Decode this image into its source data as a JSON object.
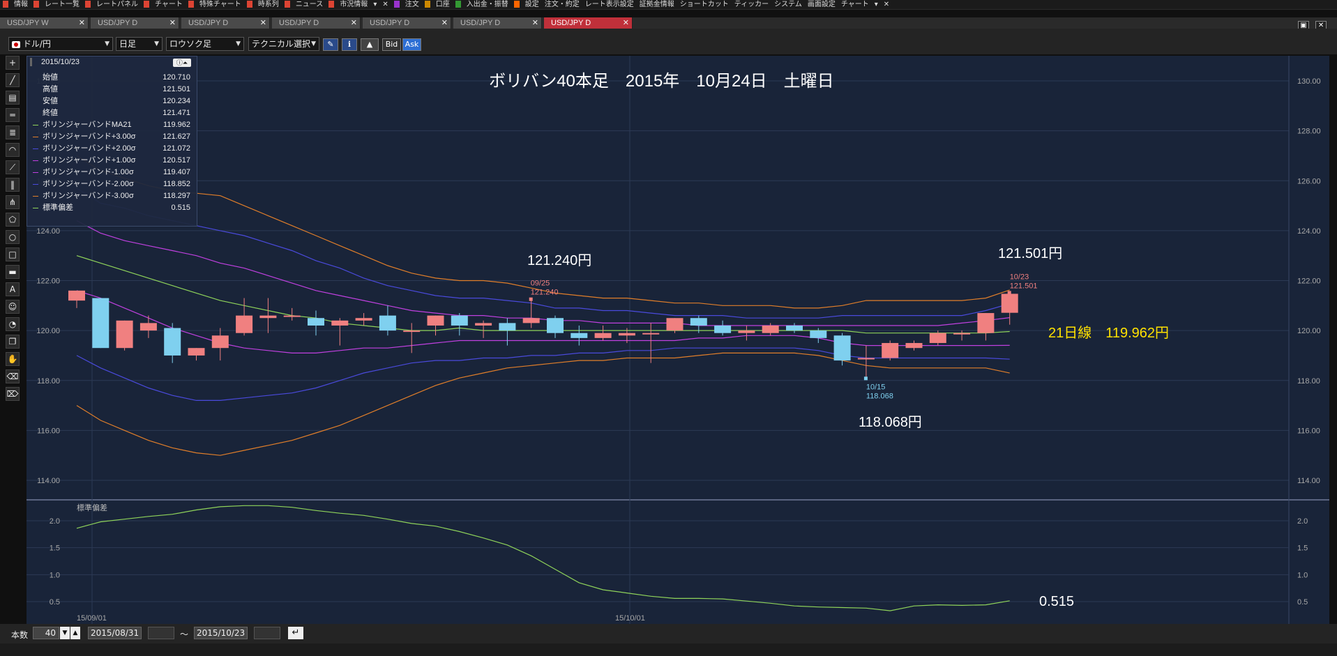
{
  "menu": {
    "items": [
      "情報",
      "レート一覧",
      "レートパネル",
      "チャート",
      "特殊チャート",
      "時系列",
      "ニュース",
      "市況情報",
      "▾",
      "✕",
      "注文",
      "口座",
      "入出金・振替",
      "設定",
      "注文・約定",
      "レート表示設定",
      "証拠金情報",
      "ショートカット",
      "ティッカー",
      "システム",
      "画面設定",
      "チャート",
      "▾",
      "✕"
    ]
  },
  "tabs": [
    {
      "label": "USD/JPY W",
      "active": false
    },
    {
      "label": "USD/JPY D",
      "active": false
    },
    {
      "label": "USD/JPY D",
      "active": false
    },
    {
      "label": "USD/JPY D",
      "active": false
    },
    {
      "label": "USD/JPY D",
      "active": false
    },
    {
      "label": "USD/JPY D",
      "active": false
    },
    {
      "label": "USD/JPY D",
      "active": true
    }
  ],
  "toolbar": {
    "symbol": "ドル/円",
    "period": "日足",
    "chart_type": "ロウソク足",
    "technical": "テクニカル選択",
    "bid_label": "Bid",
    "ask_label": "Ask"
  },
  "data_panel": {
    "date": "2015/10/23",
    "rows": [
      {
        "label": "始値",
        "value": "120.710",
        "color": ""
      },
      {
        "label": "高値",
        "value": "121.501",
        "color": ""
      },
      {
        "label": "安値",
        "value": "120.234",
        "color": ""
      },
      {
        "label": "終値",
        "value": "121.471",
        "color": ""
      },
      {
        "label": "ボリンジャーバンドMA21",
        "value": "119.962",
        "color": "#8fd35a"
      },
      {
        "label": "ボリンジャーバンド+3.00σ",
        "value": "121.627",
        "color": "#e07e2a"
      },
      {
        "label": "ボリンジャーバンド+2.00σ",
        "value": "121.072",
        "color": "#4a4adc"
      },
      {
        "label": "ボリンジャーバンド+1.00σ",
        "value": "120.517",
        "color": "#c040e0"
      },
      {
        "label": "ボリンジャーバンド-1.00σ",
        "value": "119.407",
        "color": "#c040e0"
      },
      {
        "label": "ボリンジャーバンド-2.00σ",
        "value": "118.852",
        "color": "#4a4adc"
      },
      {
        "label": "ボリンジャーバンド-3.00σ",
        "value": "118.297",
        "color": "#e07e2a"
      },
      {
        "label": "標準偏差",
        "value": "0.515",
        "color": "#8fd35a"
      }
    ]
  },
  "annotations": {
    "title": "ボリバン40本足　2015年　10月24日　土曜日",
    "high1": "121.240円",
    "high2": "121.501円",
    "low": "118.068円",
    "ma": "21日線　119.962円",
    "sd_value": "0.515",
    "mark_high1_date": "09/25",
    "mark_high1_price": "121.240",
    "mark_high2_date": "10/23",
    "mark_high2_price": "121.501",
    "mark_low_date": "10/15",
    "mark_low_price": "118.068"
  },
  "sub_panel_title": "標準偏差",
  "x_labels": [
    "15/09/01",
    "15/10/01"
  ],
  "bottom": {
    "count_label": "本数",
    "count_value": "40",
    "from_date": "2015/08/31",
    "to_sep": "～",
    "to_date": "2015/10/23"
  },
  "chart_data": {
    "type": "candlestick",
    "ylim": [
      113.5,
      130.5
    ],
    "y_ticks": [
      "114.00",
      "116.00",
      "118.00",
      "120.00",
      "122.00",
      "124.00",
      "126.00",
      "128.00",
      "130.00"
    ],
    "candles": [
      {
        "o": 121.2,
        "h": 121.4,
        "l": 120.9,
        "c": 121.6
      },
      {
        "o": 121.3,
        "h": 121.3,
        "l": 119.3,
        "c": 119.3
      },
      {
        "o": 119.3,
        "h": 120.4,
        "l": 119.2,
        "c": 120.4
      },
      {
        "o": 120.0,
        "h": 120.6,
        "l": 119.7,
        "c": 120.3
      },
      {
        "o": 120.1,
        "h": 120.3,
        "l": 118.7,
        "c": 119.0
      },
      {
        "o": 119.0,
        "h": 119.3,
        "l": 118.8,
        "c": 119.3
      },
      {
        "o": 119.3,
        "h": 120.1,
        "l": 118.8,
        "c": 119.8
      },
      {
        "o": 119.9,
        "h": 121.3,
        "l": 119.8,
        "c": 120.6
      },
      {
        "o": 120.5,
        "h": 121.3,
        "l": 119.9,
        "c": 120.6
      },
      {
        "o": 120.6,
        "h": 120.9,
        "l": 120.4,
        "c": 120.6
      },
      {
        "o": 120.5,
        "h": 120.8,
        "l": 119.8,
        "c": 120.2
      },
      {
        "o": 120.2,
        "h": 120.5,
        "l": 119.4,
        "c": 120.4
      },
      {
        "o": 120.4,
        "h": 120.7,
        "l": 120.2,
        "c": 120.5
      },
      {
        "o": 120.6,
        "h": 121.0,
        "l": 119.8,
        "c": 120.0
      },
      {
        "o": 120.0,
        "h": 120.3,
        "l": 119.1,
        "c": 120.0
      },
      {
        "o": 120.2,
        "h": 120.6,
        "l": 119.8,
        "c": 120.6
      },
      {
        "o": 120.6,
        "h": 120.7,
        "l": 119.8,
        "c": 120.2
      },
      {
        "o": 120.2,
        "h": 120.4,
        "l": 119.7,
        "c": 120.3
      },
      {
        "o": 120.3,
        "h": 120.5,
        "l": 119.4,
        "c": 120.0
      },
      {
        "o": 120.3,
        "h": 121.24,
        "l": 120.1,
        "c": 120.5
      },
      {
        "o": 120.5,
        "h": 120.6,
        "l": 119.7,
        "c": 119.9
      },
      {
        "o": 119.9,
        "h": 120.2,
        "l": 119.4,
        "c": 119.7
      },
      {
        "o": 119.7,
        "h": 120.2,
        "l": 119.6,
        "c": 119.9
      },
      {
        "o": 119.8,
        "h": 120.1,
        "l": 119.5,
        "c": 119.9
      },
      {
        "o": 119.9,
        "h": 120.3,
        "l": 118.7,
        "c": 119.9
      },
      {
        "o": 120.0,
        "h": 120.5,
        "l": 119.9,
        "c": 120.5
      },
      {
        "o": 120.5,
        "h": 120.6,
        "l": 119.9,
        "c": 120.2
      },
      {
        "o": 120.2,
        "h": 120.4,
        "l": 119.8,
        "c": 119.9
      },
      {
        "o": 119.9,
        "h": 120.2,
        "l": 119.6,
        "c": 120.0
      },
      {
        "o": 119.9,
        "h": 120.3,
        "l": 119.8,
        "c": 120.2
      },
      {
        "o": 120.2,
        "h": 120.3,
        "l": 119.9,
        "c": 120.0
      },
      {
        "o": 120.0,
        "h": 120.1,
        "l": 119.5,
        "c": 119.7
      },
      {
        "o": 119.8,
        "h": 119.9,
        "l": 118.6,
        "c": 118.8
      },
      {
        "o": 118.9,
        "h": 119.4,
        "l": 118.068,
        "c": 118.9
      },
      {
        "o": 118.9,
        "h": 119.6,
        "l": 118.8,
        "c": 119.5
      },
      {
        "o": 119.3,
        "h": 119.6,
        "l": 119.2,
        "c": 119.5
      },
      {
        "o": 119.5,
        "h": 120.0,
        "l": 119.4,
        "c": 119.9
      },
      {
        "o": 119.9,
        "h": 120.0,
        "l": 119.6,
        "c": 119.9
      },
      {
        "o": 119.9,
        "h": 120.7,
        "l": 119.6,
        "c": 120.7
      },
      {
        "o": 120.71,
        "h": 121.501,
        "l": 120.234,
        "c": 121.471
      }
    ],
    "ma21": [
      123.0,
      122.7,
      122.4,
      122.1,
      121.8,
      121.5,
      121.2,
      121.0,
      120.8,
      120.6,
      120.5,
      120.3,
      120.2,
      120.1,
      120.0,
      120.0,
      120.1,
      120.0,
      120.0,
      120.0,
      120.0,
      120.0,
      120.0,
      120.0,
      120.0,
      120.0,
      120.0,
      120.0,
      120.0,
      120.0,
      120.0,
      120.0,
      120.0,
      119.9,
      119.9,
      119.9,
      119.9,
      119.9,
      119.9,
      119.962
    ],
    "plus3": [
      127.0,
      126.4,
      126.1,
      125.8,
      125.6,
      125.5,
      125.4,
      125.0,
      124.6,
      124.2,
      123.8,
      123.4,
      123.0,
      122.6,
      122.3,
      122.1,
      122.0,
      122.0,
      121.9,
      121.7,
      121.5,
      121.4,
      121.3,
      121.3,
      121.2,
      121.1,
      121.1,
      121.0,
      121.0,
      121.0,
      120.9,
      120.9,
      121.0,
      121.2,
      121.2,
      121.2,
      121.2,
      121.2,
      121.3,
      121.627
    ],
    "plus2": [
      125.7,
      125.1,
      124.9,
      124.6,
      124.4,
      124.2,
      124.0,
      123.8,
      123.5,
      123.2,
      122.8,
      122.5,
      122.1,
      121.8,
      121.6,
      121.4,
      121.3,
      121.3,
      121.2,
      121.1,
      120.9,
      120.9,
      120.8,
      120.8,
      120.7,
      120.6,
      120.6,
      120.6,
      120.5,
      120.5,
      120.5,
      120.5,
      120.6,
      120.6,
      120.6,
      120.6,
      120.6,
      120.6,
      120.8,
      121.072
    ],
    "plus1": [
      124.4,
      123.9,
      123.6,
      123.4,
      123.2,
      123.0,
      122.7,
      122.5,
      122.2,
      121.9,
      121.6,
      121.4,
      121.2,
      121.0,
      120.8,
      120.7,
      120.6,
      120.6,
      120.5,
      120.5,
      120.4,
      120.4,
      120.3,
      120.3,
      120.3,
      120.3,
      120.2,
      120.2,
      120.2,
      120.2,
      120.2,
      120.2,
      120.2,
      120.2,
      120.2,
      120.2,
      120.2,
      120.3,
      120.4,
      120.517
    ],
    "minus1": [
      121.6,
      121.3,
      120.9,
      120.5,
      120.1,
      119.8,
      119.5,
      119.3,
      119.2,
      119.1,
      119.1,
      119.2,
      119.3,
      119.3,
      119.4,
      119.5,
      119.6,
      119.6,
      119.6,
      119.6,
      119.6,
      119.6,
      119.6,
      119.6,
      119.6,
      119.6,
      119.7,
      119.7,
      119.8,
      119.8,
      119.8,
      119.7,
      119.5,
      119.4,
      119.4,
      119.4,
      119.4,
      119.4,
      119.4,
      119.407
    ],
    "minus2": [
      119.0,
      118.5,
      118.1,
      117.7,
      117.4,
      117.2,
      117.2,
      117.3,
      117.4,
      117.5,
      117.7,
      118.0,
      118.3,
      118.5,
      118.7,
      118.8,
      118.8,
      118.9,
      118.9,
      119.0,
      119.0,
      119.1,
      119.1,
      119.2,
      119.2,
      119.3,
      119.3,
      119.3,
      119.3,
      119.3,
      119.3,
      119.2,
      119.0,
      118.9,
      118.9,
      118.9,
      118.9,
      118.9,
      118.9,
      118.852
    ],
    "minus3": [
      117.0,
      116.4,
      116.0,
      115.6,
      115.3,
      115.1,
      115.0,
      115.2,
      115.4,
      115.6,
      115.9,
      116.2,
      116.6,
      117.0,
      117.4,
      117.8,
      118.1,
      118.3,
      118.5,
      118.6,
      118.7,
      118.8,
      118.8,
      118.9,
      118.9,
      118.9,
      119.0,
      119.1,
      119.1,
      119.1,
      119.1,
      119.0,
      118.8,
      118.6,
      118.5,
      118.5,
      118.5,
      118.5,
      118.5,
      118.297
    ],
    "stddev": {
      "ylim": [
        0.3,
        2.4
      ],
      "y_ticks": [
        "0.5",
        "1.0",
        "1.5",
        "2.0"
      ],
      "values": [
        1.86,
        1.98,
        2.03,
        2.08,
        2.12,
        2.2,
        2.26,
        2.28,
        2.28,
        2.25,
        2.19,
        2.14,
        2.1,
        2.03,
        1.95,
        1.9,
        1.8,
        1.68,
        1.55,
        1.35,
        1.1,
        0.85,
        0.72,
        0.66,
        0.6,
        0.56,
        0.56,
        0.55,
        0.51,
        0.47,
        0.42,
        0.4,
        0.39,
        0.38,
        0.33,
        0.42,
        0.44,
        0.43,
        0.44,
        0.515
      ]
    }
  }
}
